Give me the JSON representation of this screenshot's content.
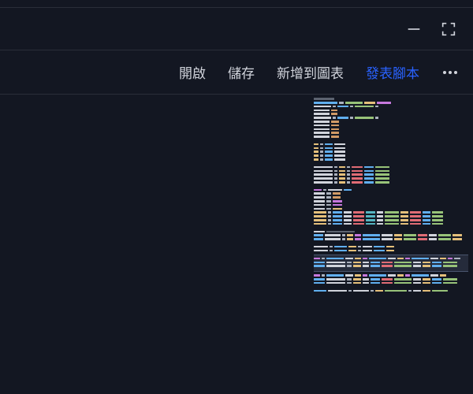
{
  "window": {
    "minimize_icon": "minimize",
    "fullscreen_icon": "fullscreen"
  },
  "menu": {
    "open": "開啟",
    "save": "儲存",
    "add_to_chart": "新增到圖表",
    "publish_script": "發表腳本",
    "more": "more"
  },
  "minimap": {
    "description": "Pine Script code minimap preview",
    "language": "pine-script",
    "line_count_approx": 52
  }
}
